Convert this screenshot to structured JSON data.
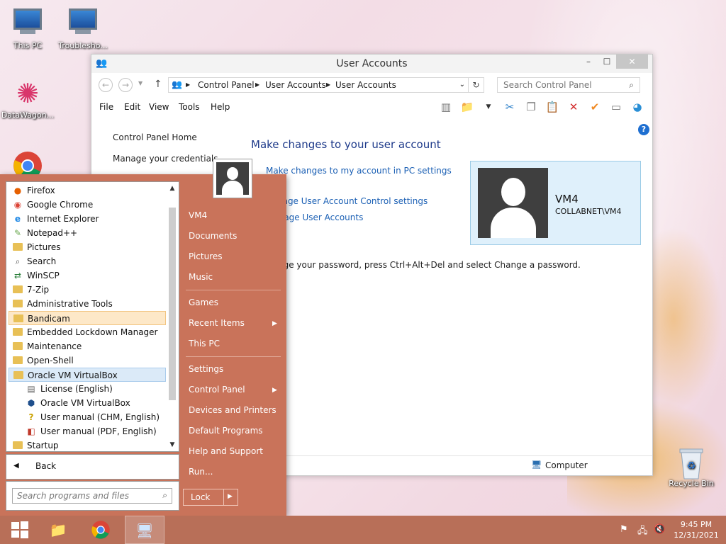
{
  "desktop": {
    "icons": [
      {
        "label": "This PC"
      },
      {
        "label": "Trouble­sho..."
      },
      {
        "label": "DataWagon..."
      },
      {
        "label": "Recycle Bin"
      }
    ]
  },
  "window": {
    "title": "User Accounts",
    "address": {
      "segments": [
        "Control Panel",
        "User Accounts",
        "User Accounts"
      ]
    },
    "search_placeholder": "Search Control Panel",
    "menu": [
      "File",
      "Edit",
      "View",
      "Tools",
      "Help"
    ],
    "left_pane": {
      "home": "Control Panel Home",
      "credentials": "Manage your credentials"
    },
    "main": {
      "title": "Make changes to your user account",
      "link_pc_settings": "Make changes to my account in PC settings",
      "link_uac": "Change User Account Control settings",
      "link_manage": "Manage User Accounts",
      "password_note": "To change your password, press Ctrl+Alt+Del and select Change a password."
    },
    "user": {
      "name": "VM4",
      "domain": "COLLABNET\\VM4"
    },
    "status": {
      "computer": "Computer"
    }
  },
  "start_menu": {
    "programs": [
      {
        "label": "Firefox",
        "icon": "firefox-icon"
      },
      {
        "label": "Google Chrome",
        "icon": "chrome-icon"
      },
      {
        "label": "Internet Explorer",
        "icon": "ie-icon"
      },
      {
        "label": "Notepad++",
        "icon": "notepadpp-icon"
      },
      {
        "label": "Pictures",
        "icon": "pictures-icon"
      },
      {
        "label": "Search",
        "icon": "search-icon"
      },
      {
        "label": "WinSCP",
        "icon": "winscp-icon"
      },
      {
        "label": "7-Zip",
        "icon": "folder-icon"
      },
      {
        "label": "Administrative Tools",
        "icon": "folder-icon"
      },
      {
        "label": "Bandicam",
        "icon": "folder-icon"
      },
      {
        "label": "Embedded Lockdown Manager",
        "icon": "folder-icon"
      },
      {
        "label": "Maintenance",
        "icon": "folder-icon"
      },
      {
        "label": "Open-Shell",
        "icon": "folder-icon"
      },
      {
        "label": "Oracle VM VirtualBox",
        "icon": "folder-icon"
      },
      {
        "label": "License (English)",
        "icon": "document-icon"
      },
      {
        "label": "Oracle VM VirtualBox",
        "icon": "virtualbox-icon"
      },
      {
        "label": "User manual (CHM, English)",
        "icon": "help-icon"
      },
      {
        "label": "User manual (PDF, English)",
        "icon": "pdf-icon"
      },
      {
        "label": "Startup",
        "icon": "folder-icon"
      }
    ],
    "back": "Back",
    "search_placeholder": "Search programs and files",
    "right": {
      "user": "VM4",
      "documents": "Documents",
      "pictures": "Pictures",
      "music": "Music",
      "games": "Games",
      "recent": "Recent Items",
      "thispc": "This PC",
      "settings": "Settings",
      "control_panel": "Control Panel",
      "devices": "Devices and Printers",
      "default_programs": "Default Programs",
      "help": "Help and Support",
      "run": "Run...",
      "lock": "Lock"
    }
  },
  "taskbar": {
    "clock_time": "9:45 PM",
    "clock_date": "12/31/2021"
  }
}
